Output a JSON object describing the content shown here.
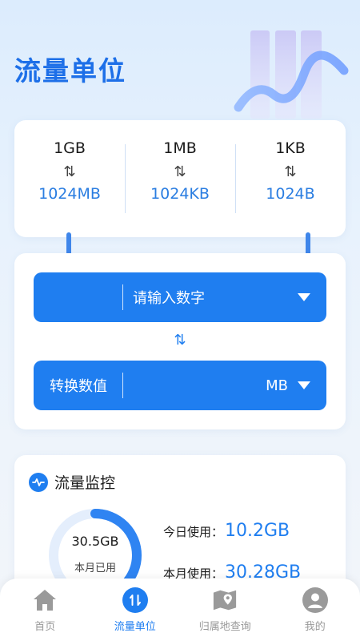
{
  "header": {
    "title": "流量单位"
  },
  "conversions": [
    {
      "from": "1GB",
      "arrow": "⇅",
      "to": "1024MB"
    },
    {
      "from": "1MB",
      "arrow": "⇅",
      "to": "1024KB"
    },
    {
      "from": "1KB",
      "arrow": "⇅",
      "to": "1024B"
    }
  ],
  "converter": {
    "input_placeholder": "请输入数字",
    "swap_arrow": "⇅",
    "result_label": "转换数值",
    "unit": "MB"
  },
  "monitor": {
    "title": "流量监控",
    "ring_value": "30.5GB",
    "ring_label": "本月已用",
    "ring_fraction": 0.55,
    "today_label": "今日使用：",
    "today_value": "10.2GB",
    "month_label": "本月使用：",
    "month_value": "30.28GB"
  },
  "tabbar": [
    {
      "label": "首页",
      "icon": "home-icon",
      "active": false
    },
    {
      "label": "流量单位",
      "icon": "swap-icon",
      "active": true
    },
    {
      "label": "归属地查询",
      "icon": "map-icon",
      "active": false
    },
    {
      "label": "我的",
      "icon": "user-icon",
      "active": false
    }
  ],
  "colors": {
    "accent": "#1f7ef0",
    "title": "#1d6fe8",
    "inactive": "#999999"
  }
}
